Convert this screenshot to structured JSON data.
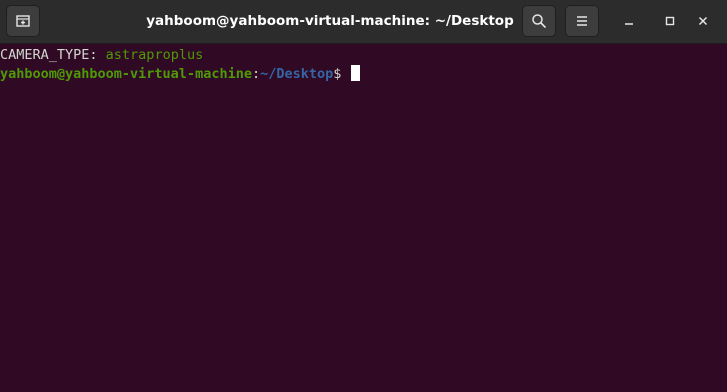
{
  "window": {
    "title": "yahboom@yahboom-virtual-machine: ~/Desktop"
  },
  "header": {
    "new_tab_icon": "new-tab-icon",
    "search_icon": "search-icon",
    "menu_icon": "hamburger-menu-icon",
    "minimize_icon": "minimize-icon",
    "maximize_icon": "maximize-icon",
    "close_icon": "close-icon"
  },
  "terminal": {
    "line1": {
      "key": "CAMERA_TYPE: ",
      "value": "astraproplus"
    },
    "prompt": {
      "user_host": "yahboom@yahboom-virtual-machine",
      "colon": ":",
      "path": "~/Desktop",
      "symbol": "$ "
    }
  },
  "colors": {
    "background": "#300a24",
    "titlebar": "#2c2c2c",
    "text": "#d3d7cf",
    "green": "#4e9a06",
    "blue": "#3465a4"
  }
}
